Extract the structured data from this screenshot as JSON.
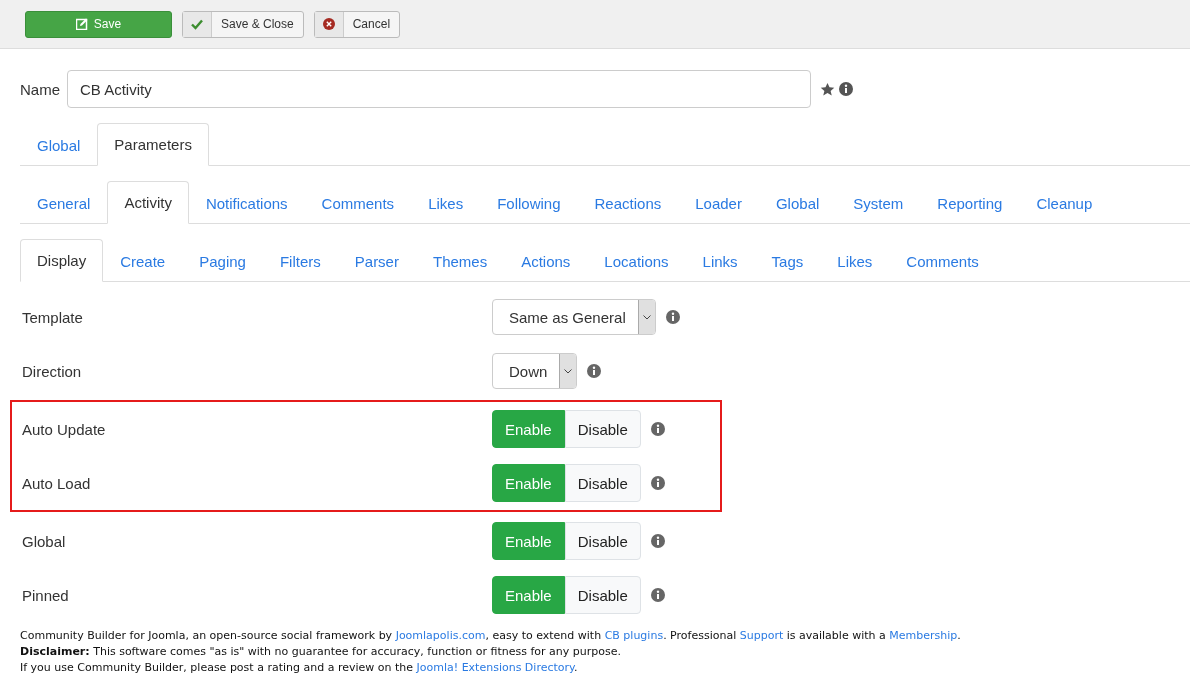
{
  "toolbar": [
    {
      "label": "Save",
      "kind": "primary"
    },
    {
      "label": "Save & Close",
      "kind": "check"
    },
    {
      "label": "Cancel",
      "kind": "cancel"
    }
  ],
  "name_field": {
    "label": "Name",
    "value": "CB Activity"
  },
  "tab_rows": [
    [
      {
        "label": "Global",
        "selected": false
      },
      {
        "label": "Parameters",
        "selected": true
      }
    ],
    [
      {
        "label": "General",
        "selected": false
      },
      {
        "label": "Activity",
        "selected": true
      },
      {
        "label": "Notifications",
        "selected": false
      },
      {
        "label": "Comments",
        "selected": false
      },
      {
        "label": "Likes",
        "selected": false
      },
      {
        "label": "Following",
        "selected": false
      },
      {
        "label": "Reactions",
        "selected": false
      },
      {
        "label": "Loader",
        "selected": false
      },
      {
        "label": "Global",
        "selected": false
      },
      {
        "label": "System",
        "selected": false
      },
      {
        "label": "Reporting",
        "selected": false
      },
      {
        "label": "Cleanup",
        "selected": false
      }
    ],
    [
      {
        "label": "Display",
        "selected": true
      },
      {
        "label": "Create",
        "selected": false
      },
      {
        "label": "Paging",
        "selected": false
      },
      {
        "label": "Filters",
        "selected": false
      },
      {
        "label": "Parser",
        "selected": false
      },
      {
        "label": "Themes",
        "selected": false
      },
      {
        "label": "Actions",
        "selected": false
      },
      {
        "label": "Locations",
        "selected": false
      },
      {
        "label": "Links",
        "selected": false
      },
      {
        "label": "Tags",
        "selected": false
      },
      {
        "label": "Likes",
        "selected": false
      },
      {
        "label": "Comments",
        "selected": false
      }
    ]
  ],
  "fields": [
    {
      "label": "Template",
      "kind": "select",
      "value": "Same as General",
      "highlighted": false
    },
    {
      "label": "Direction",
      "kind": "select",
      "value": "Down",
      "highlighted": false
    },
    {
      "label": "Auto Update",
      "kind": "toggle",
      "options": [
        {
          "label": "Enable",
          "selected": true
        },
        {
          "label": "Disable",
          "selected": false
        }
      ],
      "highlighted": true
    },
    {
      "label": "Auto Load",
      "kind": "toggle",
      "options": [
        {
          "label": "Enable",
          "selected": true
        },
        {
          "label": "Disable",
          "selected": false
        }
      ],
      "highlighted": true
    },
    {
      "label": "Global",
      "kind": "toggle",
      "options": [
        {
          "label": "Enable",
          "selected": true
        },
        {
          "label": "Disable",
          "selected": false
        }
      ],
      "highlighted": false
    },
    {
      "label": "Pinned",
      "kind": "toggle",
      "options": [
        {
          "label": "Enable",
          "selected": true
        },
        {
          "label": "Disable",
          "selected": false
        }
      ],
      "highlighted": false
    }
  ],
  "footer": [
    [
      {
        "text": "Community Builder for Joomla, an open-source social framework by "
      },
      {
        "text": "Joomlapolis.com",
        "link": true
      },
      {
        "text": ", easy to extend with "
      },
      {
        "text": "CB plugins",
        "link": true
      },
      {
        "text": ". Professional "
      },
      {
        "text": "Support",
        "link": true
      },
      {
        "text": " is available with a "
      },
      {
        "text": "Membership",
        "link": true
      },
      {
        "text": "."
      }
    ],
    [
      {
        "text": "**Disclaimer:** This software comes \"as is\" with no guarantee for accuracy, function or fitness for any purpose."
      }
    ],
    [
      {
        "text": "If you use Community Builder, please post a rating and a review on the "
      },
      {
        "text": "Joomla! Extensions Directory",
        "link": true
      },
      {
        "text": "."
      }
    ]
  ]
}
